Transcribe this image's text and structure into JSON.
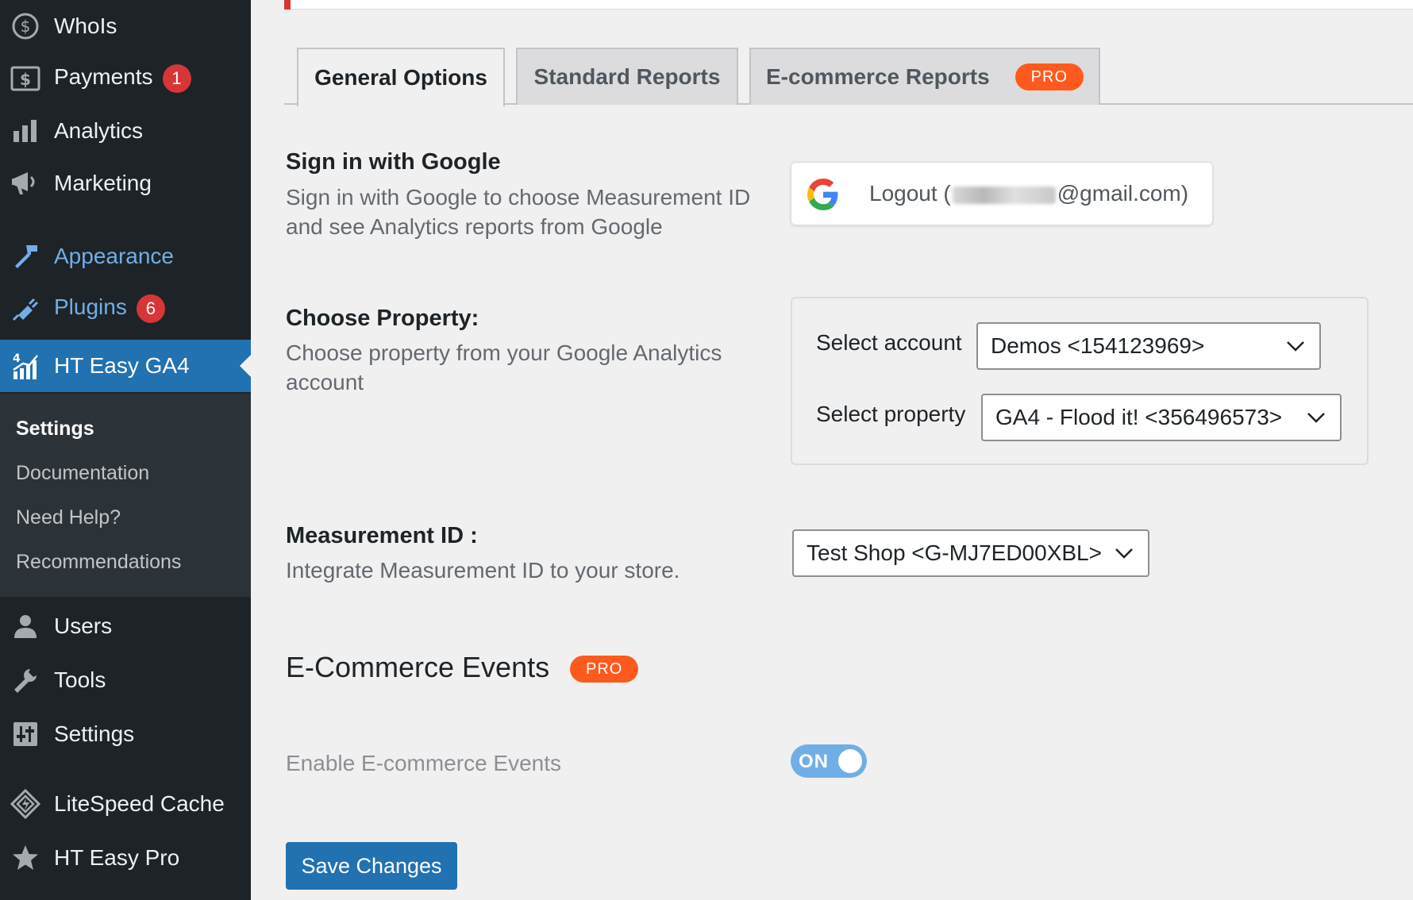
{
  "sidebar": {
    "items": [
      {
        "label": "WhoIs",
        "icon": "dollar-circle-icon"
      },
      {
        "label": "Payments",
        "icon": "payments-icon",
        "badge": "1"
      },
      {
        "label": "Analytics",
        "icon": "bar-chart-icon"
      },
      {
        "label": "Marketing",
        "icon": "megaphone-icon"
      },
      {
        "label": "Appearance",
        "icon": "paintbrush-icon"
      },
      {
        "label": "Plugins",
        "icon": "plug-icon",
        "badge": "6"
      },
      {
        "label": "HT Easy GA4",
        "icon": "ga4-chart-icon"
      },
      {
        "label": "Users",
        "icon": "user-icon"
      },
      {
        "label": "Tools",
        "icon": "wrench-icon"
      },
      {
        "label": "Settings",
        "icon": "sliders-icon"
      },
      {
        "label": "LiteSpeed Cache",
        "icon": "diamond-icon"
      },
      {
        "label": "HT Easy Pro",
        "icon": "star-icon"
      }
    ],
    "submenu": [
      "Settings",
      "Documentation",
      "Need Help?",
      "Recommendations"
    ]
  },
  "tabs": [
    {
      "label": "General Options",
      "active": true
    },
    {
      "label": "Standard Reports",
      "active": false
    },
    {
      "label": "E-commerce Reports",
      "active": false,
      "badge": "PRO"
    }
  ],
  "sign_in": {
    "title": "Sign in with Google",
    "description": "Sign in with Google to choose Measurement ID and see Analytics reports from Google",
    "button_prefix": "Logout (",
    "button_suffix": "@gmail.com)"
  },
  "property": {
    "title": "Choose Property:",
    "description": "Choose property from your Google Analytics account",
    "account_label": "Select account",
    "account_value": "Demos <154123969>",
    "property_label": "Select property",
    "property_value": "GA4 - Flood it! <356496573>"
  },
  "measurement": {
    "title": "Measurement ID :",
    "description": "Integrate Measurement ID to your store.",
    "value": "Test Shop <G-MJ7ED00XBL>"
  },
  "ecommerce": {
    "title": "E-Commerce Events",
    "badge": "PRO",
    "toggle_label": "Enable E-commerce Events",
    "toggle_state": "ON"
  },
  "save_label": "Save Changes",
  "colors": {
    "sidebar_bg": "#1d2327",
    "accent": "#2271b1",
    "pro": "#fe5a1d",
    "badge": "#d63638"
  }
}
